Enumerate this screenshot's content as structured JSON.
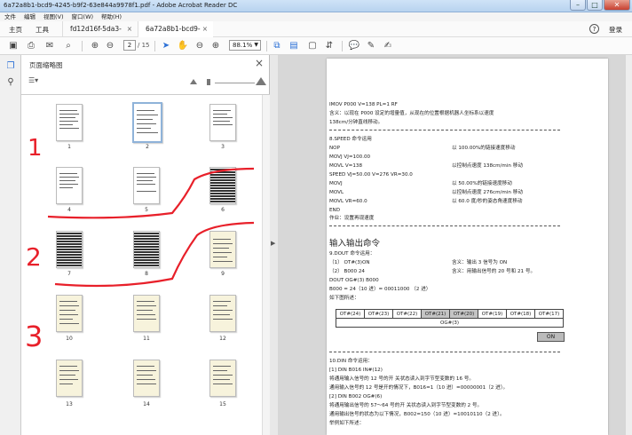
{
  "window": {
    "title": "6a72a8b1-bcd9-4245-b9f2-63e844a9978f1.pdf - Adobe Acrobat Reader DC",
    "min": "–",
    "max": "□",
    "close": "✕"
  },
  "menu": [
    "文件",
    "编辑",
    "视图(V)",
    "窗口(W)",
    "帮助(H)"
  ],
  "tabs": {
    "home": "主页",
    "tools": "工具",
    "doc1": "fd12d16f-5da3-4fb...",
    "doc2": "6a72a8b1-bcd9-42...",
    "close": "×"
  },
  "header": {
    "help": "?",
    "login": "登录"
  },
  "toolbar": {
    "page_current": "2",
    "page_total": "/ 15",
    "zoom": "88.1%"
  },
  "panel": {
    "title": "页面缩略图",
    "close": "×",
    "options": "☰▾"
  },
  "thumbnails": [
    "1",
    "2",
    "3",
    "4",
    "5",
    "6",
    "7",
    "8",
    "9",
    "10",
    "11",
    "12",
    "13",
    "14",
    "15"
  ],
  "annotations": [
    "1",
    "2",
    "3"
  ],
  "doc": {
    "l1": "IMOV P000 V=138 PL=1 RF",
    "l2": "含义：以现在 P000 设定的增量值，从现在的位置根据机器人坐标系以速度",
    "l3": "138cm/分钟直线移动。",
    "s8": "8.SPEED 命令运用",
    "r1l": "NOP",
    "r1r": "",
    "r2l": "MOVJ VJ=100.00",
    "r2r": "以 100.00%的链接速度移动",
    "r3l": "MOVL V=138",
    "r3r": "以控制点速度 138cm/min 移动",
    "r4l": "SPEED VJ=50.00 V=276 VR=30.0",
    "r4r": "",
    "r5l": "MOVJ",
    "r5r": "以 50.00%的链接速度移动",
    "r6l": "MOVL",
    "r6r": "以控制点速度 276cm/min 移动",
    "r7l": "MOVL VR=60.0",
    "r7r": "以 60.0 度/秒的姿态角速度移动",
    "r8l": "END",
    "r8r": "",
    "note": "作业：设置再现速度",
    "section": "输入输出命令",
    "s9": "9.DOUT 命令运用：",
    "d1l": "（1）  OT#(3)ON",
    "d1r": "含义：输出 3 信号为 ON",
    "d2l": "（2）  B000 24",
    "d2r": "含义：用输出信号的 20 号和 21 号。",
    "d3": "DOUT OG#(3) B000",
    "d4": "B000 = 24（10 进）= 00011000 （2 进）",
    "d5": "如下图所述：",
    "ot": [
      "OT#(24)",
      "OT#(23)",
      "OT#(22)",
      "OT#(21)",
      "OT#(20)",
      "OT#(19)",
      "OT#(18)",
      "OT#(17)"
    ],
    "og": "OG#(3)",
    "on": "ON",
    "s10": "10.DIN 命令运用：",
    "e1": "[1] DIN B016 IN#(12)",
    "e2": "将通用输入信号的 12 号的开  关状态读入到字节型变数的 16 号。",
    "e3": "通用输入信号的 12 号是开的情况下，B016=1（10 进）=00000001（2 进）。",
    "e4": "[2] DIN B002 OG#(6)",
    "e5": "将通用输出信号的 57～64 号的开  关状态读入到字节型变数的 2 号。",
    "e6": "通用输出信号的状态为以下情况，B002=150（10 进）=10010110（2 进）。",
    "e7": "举例如下所述："
  },
  "colors": {
    "annotation": "#e8202a",
    "selected_border": "#8fb3d9",
    "dark_cell": "#c4c4c4"
  }
}
